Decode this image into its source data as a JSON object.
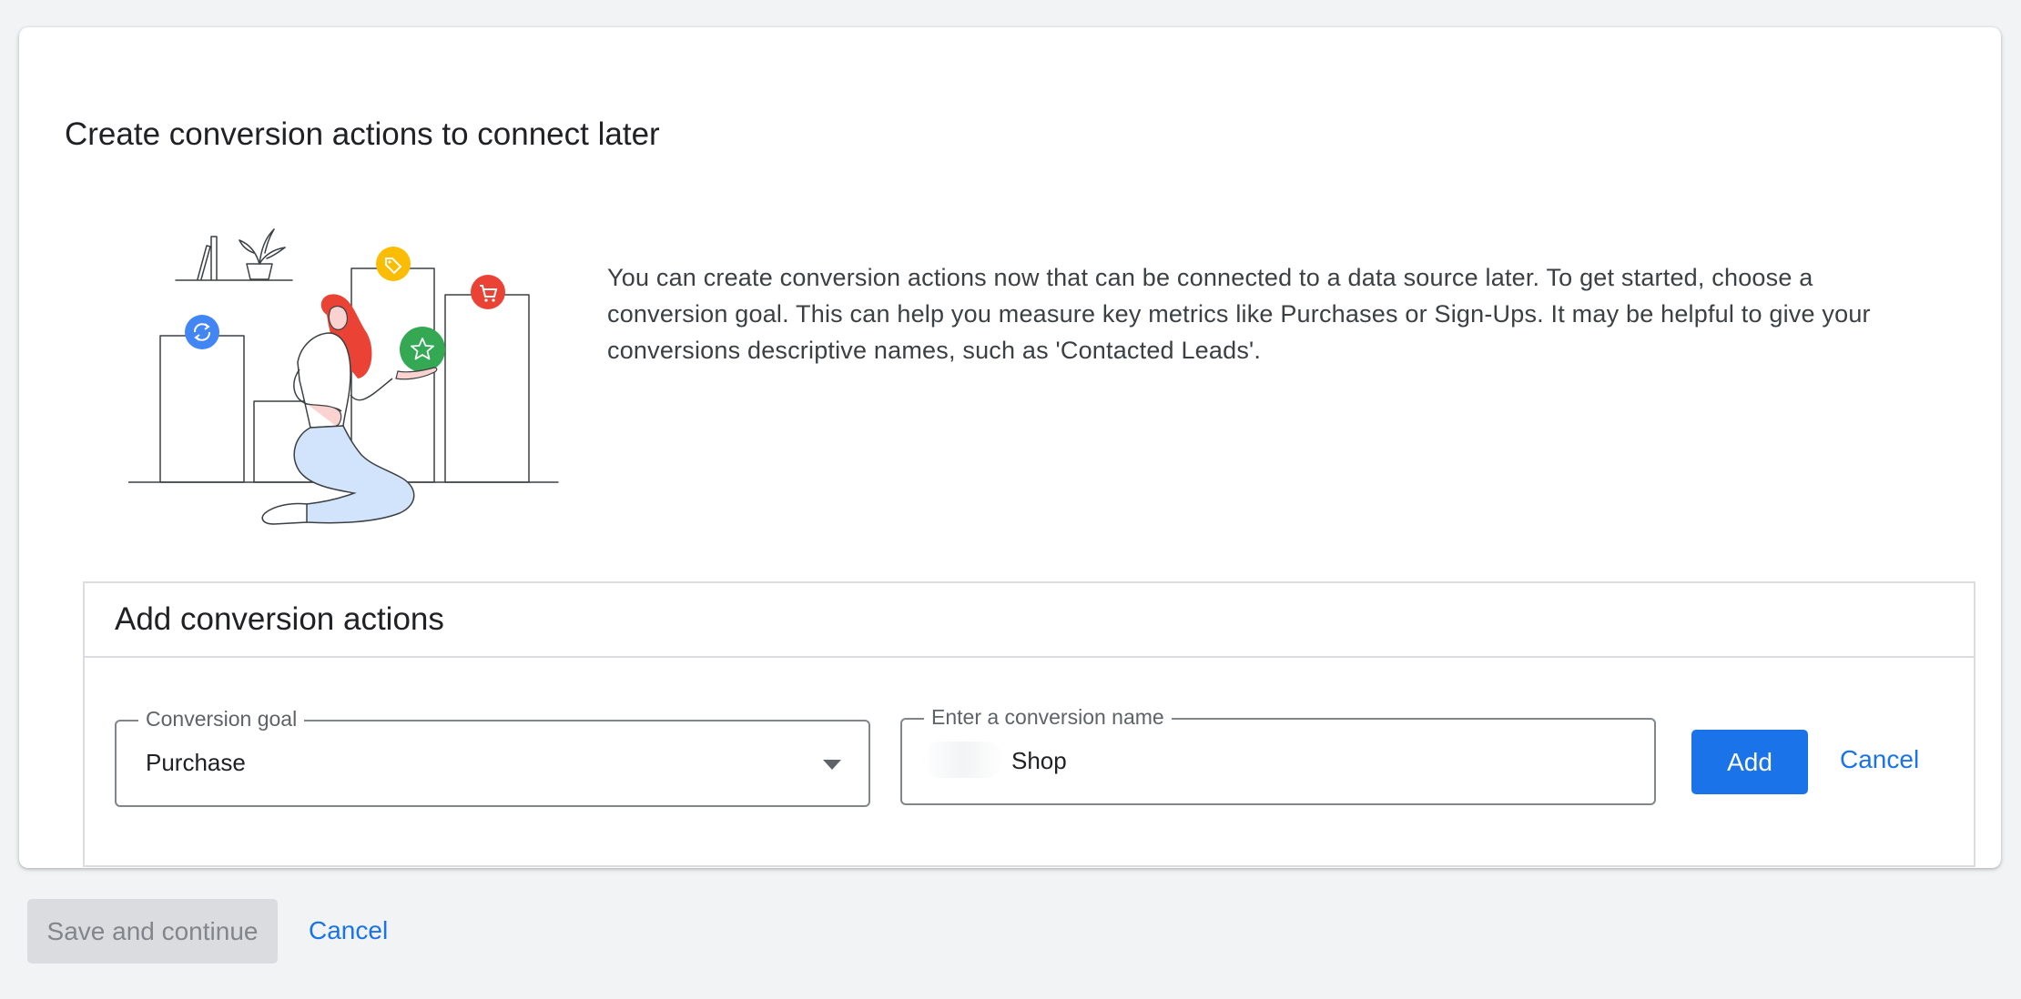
{
  "card": {
    "title": "Create conversion actions to connect later",
    "intro": "You can create conversion actions now that can be connected to a data source later. To get started, choose a conversion goal. This can help you measure key metrics like Purchases or Sign-Ups. It may be helpful to give your conversions descriptive names, such as 'Contacted Leads'."
  },
  "add_section": {
    "title": "Add conversion actions",
    "goal_label": "Conversion goal",
    "goal_value": "Purchase",
    "name_label": "Enter a conversion name",
    "name_value": "Shop",
    "add_label": "Add",
    "cancel_label": "Cancel"
  },
  "footer": {
    "save_label": "Save and continue",
    "cancel_label": "Cancel"
  },
  "colors": {
    "accent": "#1a73e8",
    "illustration_blue": "#4285f4",
    "illustration_yellow": "#fbbc04",
    "illustration_red": "#ea4335",
    "illustration_green": "#34a853",
    "pants": "#d2e3fc"
  },
  "icons": {
    "sync": "sync-icon",
    "tag": "tag-icon",
    "cart": "cart-icon",
    "star": "star-icon",
    "dropdown": "dropdown-arrow-icon"
  }
}
